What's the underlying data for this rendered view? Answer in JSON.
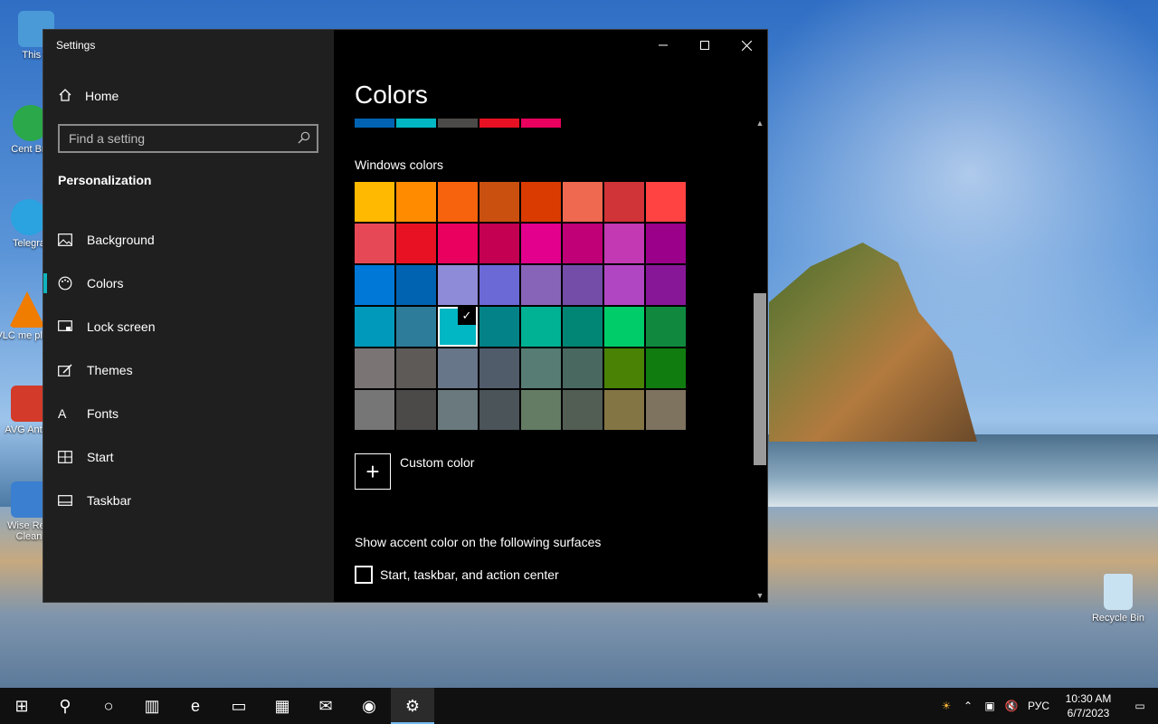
{
  "desktop": {
    "icons": [
      {
        "label": "This P",
        "color": "#4a9ad8"
      },
      {
        "label": "Cent Bro",
        "color": "#2aa84a"
      },
      {
        "label": "Telegra",
        "color": "#2aa3e0"
      },
      {
        "label": "VLC me playe",
        "color": "#f07c00"
      },
      {
        "label": "AVG AntiVi",
        "color": "#d33a2a"
      },
      {
        "label": "Wise Reg Clean",
        "color": "#3a7fd0"
      },
      {
        "label": "Recycle Bin",
        "color": "#c9e2f2"
      }
    ]
  },
  "window": {
    "title": "Settings",
    "minimize_icon": "minimize-icon",
    "maximize_icon": "maximize-icon",
    "close_icon": "close-icon"
  },
  "sidebar": {
    "home_label": "Home",
    "search_placeholder": "Find a setting",
    "section_heading": "Personalization",
    "items": [
      {
        "label": "Background",
        "icon": "picture-icon"
      },
      {
        "label": "Colors",
        "icon": "palette-icon"
      },
      {
        "label": "Lock screen",
        "icon": "lock-screen-icon"
      },
      {
        "label": "Themes",
        "icon": "themes-icon"
      },
      {
        "label": "Fonts",
        "icon": "fonts-icon"
      },
      {
        "label": "Start",
        "icon": "start-icon"
      },
      {
        "label": "Taskbar",
        "icon": "taskbar-icon"
      }
    ],
    "active_index": 1,
    "accent": "#0fb3bf"
  },
  "main": {
    "title": "Colors",
    "recent_colors": [
      "#0063b1",
      "#00b7c3",
      "#4c4a48",
      "#e81123",
      "#ea005e"
    ],
    "windows_colors_label": "Windows colors",
    "swatches": [
      "#ffb900",
      "#ff8c00",
      "#f7630c",
      "#ca5010",
      "#da3b01",
      "#ef6950",
      "#d13438",
      "#ff4343",
      "#e74856",
      "#e81123",
      "#ea005e",
      "#c30052",
      "#e3008c",
      "#bf0077",
      "#c239b3",
      "#9a0089",
      "#0078d7",
      "#0063b1",
      "#8e8cd8",
      "#6b69d6",
      "#8764b8",
      "#744da9",
      "#b146c2",
      "#881798",
      "#0099bc",
      "#2d7d9a",
      "#00b7c3",
      "#038387",
      "#00b294",
      "#018574",
      "#00cc6a",
      "#10893e",
      "#7a7574",
      "#5d5a58",
      "#68768a",
      "#515c6b",
      "#567c73",
      "#486860",
      "#498205",
      "#107c10",
      "#767676",
      "#4c4a48",
      "#69797e",
      "#4a5459",
      "#647c64",
      "#525e54",
      "#847545",
      "#7e735f"
    ],
    "selected_index": 26,
    "custom_color_label": "Custom color",
    "surfaces_label": "Show accent color on the following surfaces",
    "checkbox_label": "Start, taskbar, and action center",
    "checkbox_checked": false
  },
  "taskbar": {
    "items": [
      {
        "name": "windows-start-icon",
        "glyph": "⊞"
      },
      {
        "name": "search-icon",
        "glyph": "⚲"
      },
      {
        "name": "cortana-icon",
        "glyph": "○"
      },
      {
        "name": "task-view-icon",
        "glyph": "▥"
      },
      {
        "name": "edge-icon",
        "glyph": "e"
      },
      {
        "name": "file-explorer-icon",
        "glyph": "▭"
      },
      {
        "name": "store-icon",
        "glyph": "▦"
      },
      {
        "name": "mail-icon",
        "glyph": "✉"
      },
      {
        "name": "cent-browser-icon",
        "glyph": "◉"
      },
      {
        "name": "settings-icon",
        "glyph": "⚙"
      }
    ],
    "active_index": 9,
    "tray": {
      "weather_icon": "weather-icon",
      "chevron_icon": "chevron-up-icon",
      "network_icon": "network-icon",
      "volume_icon": "volume-muted-icon",
      "language": "РУС",
      "time": "10:30 AM",
      "date": "6/7/2023",
      "notification_icon": "action-center-icon"
    }
  }
}
